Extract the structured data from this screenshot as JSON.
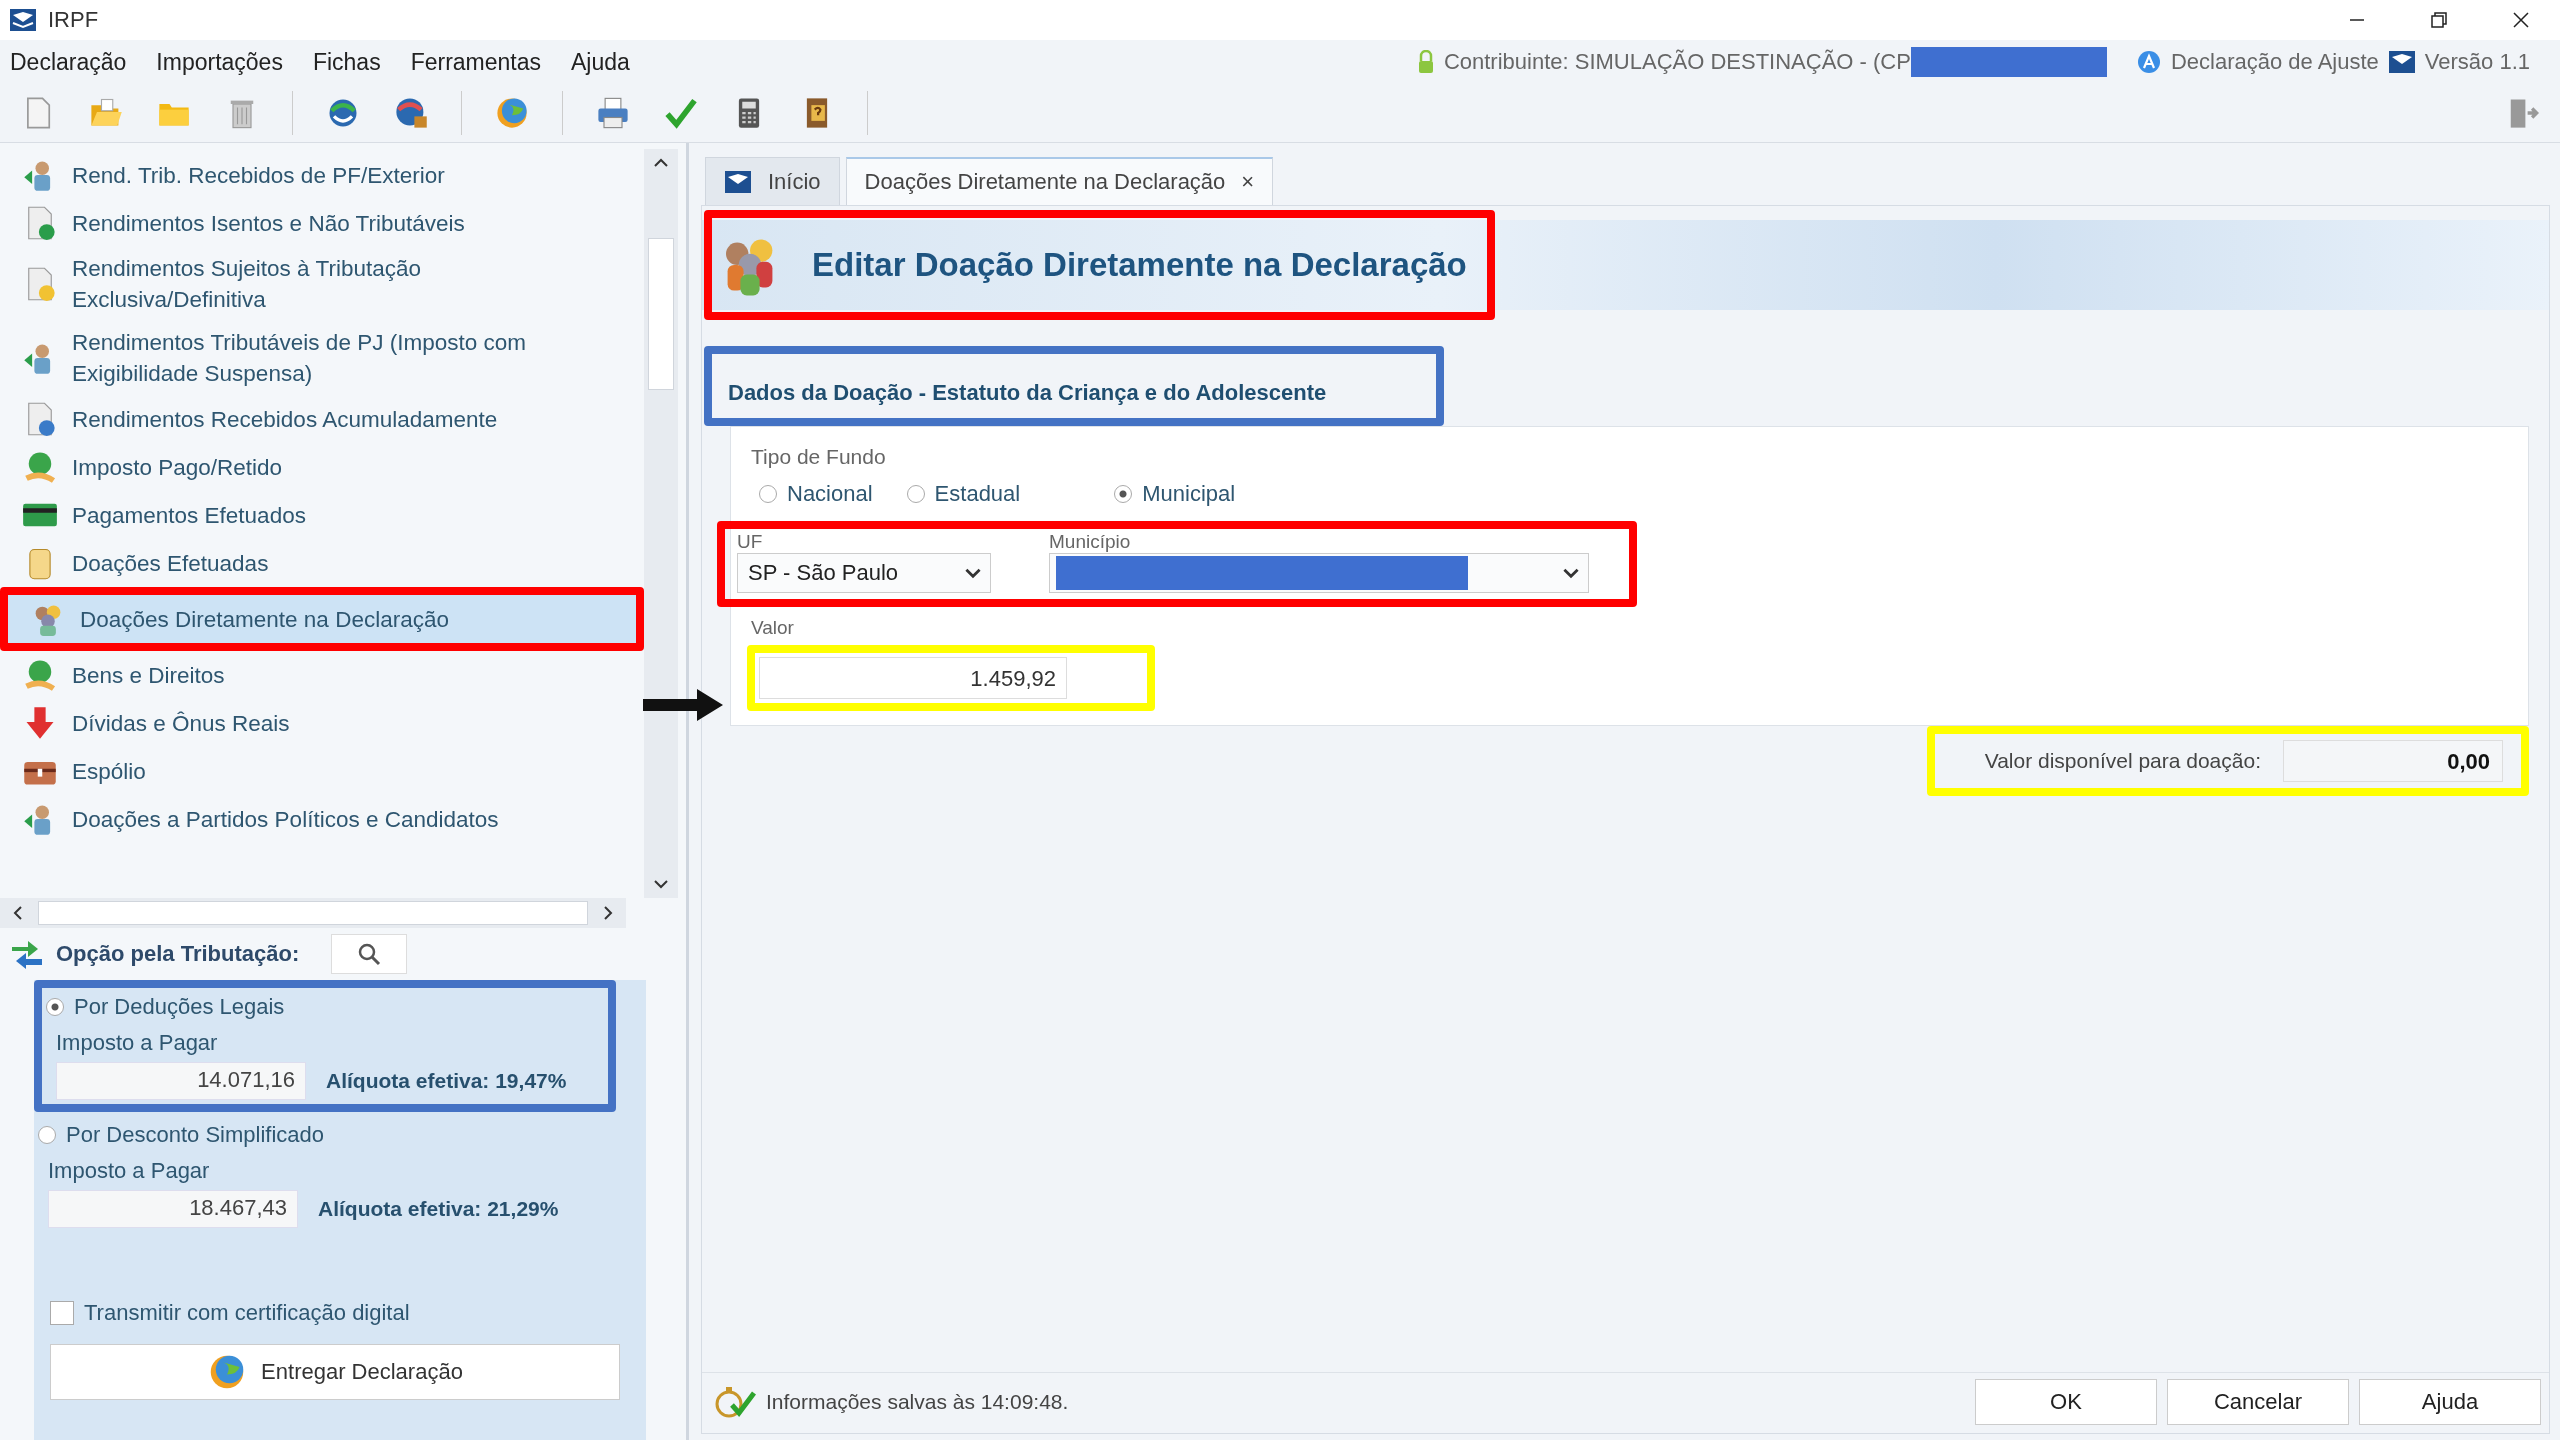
{
  "window": {
    "title": "IRPF"
  },
  "menu": [
    {
      "label": "Declaração"
    },
    {
      "label": "Importações"
    },
    {
      "label": "Fichas"
    },
    {
      "label": "Ferramentas"
    },
    {
      "label": "Ajuda"
    }
  ],
  "status": {
    "taxpayer": "Contribuinte: SIMULAÇÃO DESTINAÇÃO - (CP",
    "declaration": "Declaração de Ajuste",
    "version": "Versão 1.1"
  },
  "sidebar": {
    "items": [
      {
        "label": "Rend. Trib. Recebidos de PF/Exterior",
        "selected": false
      },
      {
        "label": "Rendimentos Isentos e Não Tributáveis",
        "selected": false
      },
      {
        "label": "Rendimentos Sujeitos à Tributação Exclusiva/Definitiva",
        "selected": false
      },
      {
        "label": "Rendimentos Tributáveis de PJ (Imposto com Exigibilidade Suspensa)",
        "selected": false
      },
      {
        "label": "Rendimentos Recebidos Acumuladamente",
        "selected": false
      },
      {
        "label": "Imposto Pago/Retido",
        "selected": false
      },
      {
        "label": "Pagamentos Efetuados",
        "selected": false
      },
      {
        "label": "Doações Efetuadas",
        "selected": false
      },
      {
        "label": "Doações Diretamente na Declaração",
        "selected": true,
        "annotation": {
          "color": "#ff0000"
        }
      },
      {
        "label": "Bens e Direitos",
        "selected": false
      },
      {
        "label": "Dívidas e Ônus Reais",
        "selected": false
      },
      {
        "label": "Espólio",
        "selected": false
      },
      {
        "label": "Doações a Partidos Políticos e Candidatos",
        "selected": false
      }
    ]
  },
  "tax_option": {
    "title": "Opção pela Tributação:",
    "options": [
      {
        "label": "Por Deduções Legais",
        "selected": true,
        "tax_label": "Imposto a Pagar",
        "tax_value": "14.071,16",
        "rate": "Alíquota efetiva: 19,47%",
        "annotation": {
          "color": "#4472c4"
        }
      },
      {
        "label": "Por Desconto Simplificado",
        "selected": false,
        "tax_label": "Imposto a Pagar",
        "tax_value": "18.467,43",
        "rate": "Alíquota efetiva: 21,29%"
      }
    ],
    "certificate": {
      "label": "Transmitir com certificação digital",
      "checked": false
    },
    "submit": "Entregar Declaração"
  },
  "tabs": [
    {
      "label": "Início",
      "selected": false,
      "closable": false
    },
    {
      "label": "Doações Diretamente na Declaração",
      "selected": true,
      "closable": true,
      "close_glyph": "×"
    }
  ],
  "form": {
    "title": "Editar Doação Diretamente na Declaração",
    "title_annotation": {
      "color": "#ff0000"
    },
    "section": "Dados da Doação - Estatuto da Criança e do Adolescente",
    "section_annotation": {
      "color": "#4472c4"
    },
    "fund_label": "Tipo de Fundo",
    "funds": [
      {
        "label": "Nacional",
        "selected": false
      },
      {
        "label": "Estadual",
        "selected": false
      },
      {
        "label": "Municipal",
        "selected": true
      }
    ],
    "uf": {
      "label": "UF",
      "value": "SP - São Paulo"
    },
    "municipio": {
      "label": "Município"
    },
    "location_annotation": {
      "color": "#ff0000"
    },
    "valor": {
      "label": "Valor",
      "value": "1.459,92"
    },
    "valor_annotation": {
      "color": "#ffff00"
    },
    "available": {
      "label": "Valor disponível para doação:",
      "value": "0,00"
    },
    "available_annotation": {
      "color": "#ffff00"
    }
  },
  "status_bar": {
    "message": "Informações salvas às 14:09:48."
  },
  "buttons": [
    {
      "label": "OK"
    },
    {
      "label": "Cancelar"
    },
    {
      "label": "Ajuda"
    }
  ]
}
